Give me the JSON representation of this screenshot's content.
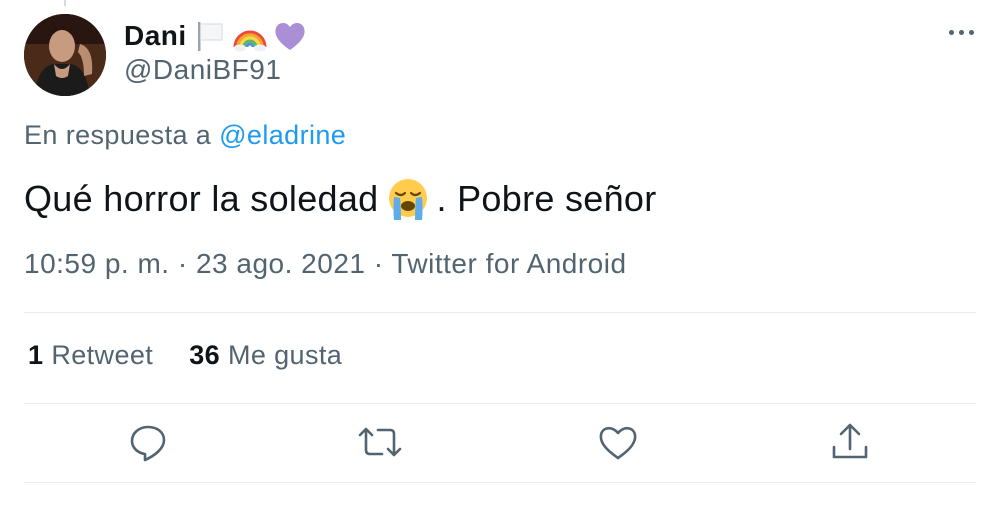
{
  "author": {
    "display_name": "Dani",
    "handle": "@DaniBF91",
    "badge_icons": [
      "white-flag-icon",
      "rainbow-icon",
      "purple-heart-icon"
    ]
  },
  "reply": {
    "prefix": "En respuesta a",
    "mention": "@eladrine"
  },
  "tweet": {
    "text_before": "Qué horror la soledad",
    "emoji": "loudly-crying-face-icon",
    "text_after": ". Pobre señor"
  },
  "meta": {
    "time": "10:59 p. m.",
    "date": "23 ago. 2021",
    "source": "Twitter for Android",
    "separator": "·"
  },
  "stats": {
    "retweets_count": "1",
    "retweets_label": "Retweet",
    "likes_count": "36",
    "likes_label": "Me gusta"
  },
  "actions": [
    "reply-icon",
    "retweet-icon",
    "like-icon",
    "share-icon"
  ],
  "colors": {
    "text": "#0f1419",
    "secondary": "#536471",
    "link": "#1d9bf0",
    "divider": "#e6ecf0"
  }
}
